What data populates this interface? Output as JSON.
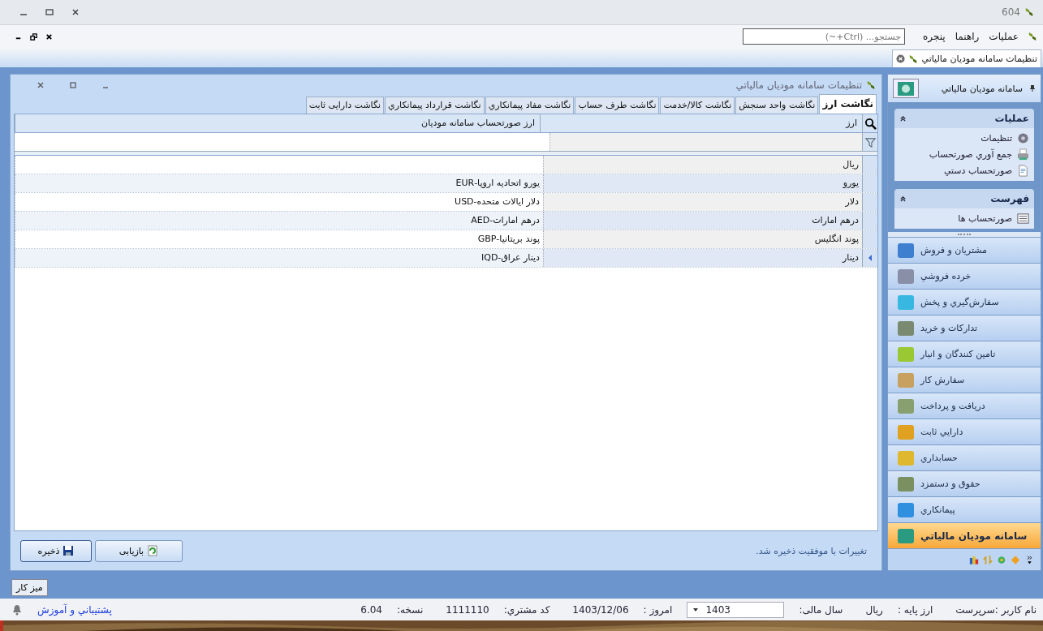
{
  "window": {
    "title": "604"
  },
  "menu": [
    "عملیات",
    "راهنما",
    "پنجره"
  ],
  "search": {
    "placeholder": "جستجو... (Ctrl+~)"
  },
  "doc_tabs": [
    {
      "label": "تنظیمات سامانه مودیان مالیاتي",
      "selected": true
    }
  ],
  "form": {
    "title": "تنظیمات سامانه مودیان مالیاتي",
    "tabs": [
      {
        "label": "نگاشت ارز",
        "selected": true
      },
      {
        "label": "نگاشت واحد سنجش",
        "selected": false
      },
      {
        "label": "نگاشت کالا/خدمت",
        "selected": false
      },
      {
        "label": "نگاشت طرف حساب",
        "selected": false
      },
      {
        "label": "نگاشت مفاد پیمانکاري",
        "selected": false
      },
      {
        "label": "نگاشت قرارداد پیمانکاري",
        "selected": false
      },
      {
        "label": "نگاشت دارایی ثابت",
        "selected": false
      }
    ],
    "grid": {
      "columns": [
        "ارز",
        "ارز صورتحساب سامانه مودیان"
      ],
      "rows": [
        {
          "currency": "ریال",
          "selected": false
        },
        {
          "currency": "یورو",
          "mapping": "یورو اتحادیه اروپا-EUR",
          "selected": false
        },
        {
          "currency": "دلار",
          "mapping": "دلار ایالات متحده-USD",
          "selected": false
        },
        {
          "currency": "درهم امارات",
          "mapping": "درهم امارات-AED",
          "selected": false
        },
        {
          "currency": "پوند انگلیس",
          "mapping": "پوند بریتانیا-GBP",
          "selected": false
        },
        {
          "currency": "دینار",
          "mapping": "دینار عراق-IQD",
          "selected": true
        }
      ]
    },
    "status_message": "تغییرات با موفقیت ذخیره شد.",
    "buttons": [
      {
        "label": "بازیابی",
        "kind": "restore"
      },
      {
        "label": "ذخیره",
        "kind": "save"
      }
    ]
  },
  "sidebar": {
    "header": "سامانه مودیان مالیاتي",
    "groups": [
      {
        "title": "عملیات",
        "expanded": true,
        "items": [
          {
            "label": "تنظیمات",
            "kind": "gear"
          },
          {
            "label": "جمع آوري صورتحساب",
            "kind": "printer"
          },
          {
            "label": "صورتحساب دستي",
            "kind": "doc"
          }
        ]
      },
      {
        "title": "فهرست",
        "expanded": true,
        "items": [
          {
            "label": "صورتحساب ها",
            "kind": "list"
          }
        ]
      }
    ],
    "nav": [
      {
        "label": "مشتریان و فروش",
        "selected": false,
        "color": "#3f7fd0"
      },
      {
        "label": "خرده فروشي",
        "selected": false,
        "color": "#8a8fa8"
      },
      {
        "label": "سفارش‌گیري و پخش",
        "selected": false,
        "color": "#38b8e0"
      },
      {
        "label": "تدارکات و خرید",
        "selected": false,
        "color": "#7a8a70"
      },
      {
        "label": "تامین کنندگان و انبار",
        "selected": false,
        "color": "#9ac832"
      },
      {
        "label": "سفارش کار",
        "selected": false,
        "color": "#c8a060"
      },
      {
        "label": "دریافت و پرداخت",
        "selected": false,
        "color": "#88a070"
      },
      {
        "label": "دارایي ثابت",
        "selected": false,
        "color": "#e0a020"
      },
      {
        "label": "حسابداري",
        "selected": false,
        "color": "#e0b830"
      },
      {
        "label": "حقوق و دستمزد",
        "selected": false,
        "color": "#7a9060"
      },
      {
        "label": "پیمانکاري",
        "selected": false,
        "color": "#3090e0"
      },
      {
        "label": "سامانه مودیان مالیاتي",
        "selected": true,
        "color": "#2a9a80"
      }
    ]
  },
  "taskbar": [
    {
      "label": "میز کار"
    }
  ],
  "status_bar": {
    "user": "نام کاربر :سرپرست",
    "base_currency_label": "ارز پایه :",
    "base_currency": "ریال",
    "fiscal_year_label": "سال مالی:",
    "fiscal_year": "1403",
    "today_label": "امروز :",
    "today": "1403/12/06",
    "customer_code_label": "کد مشتري:",
    "customer_code": "1111110",
    "version_label": "نسخه:",
    "version": "6.04",
    "support_link": "پشتيباني و آموزش"
  }
}
